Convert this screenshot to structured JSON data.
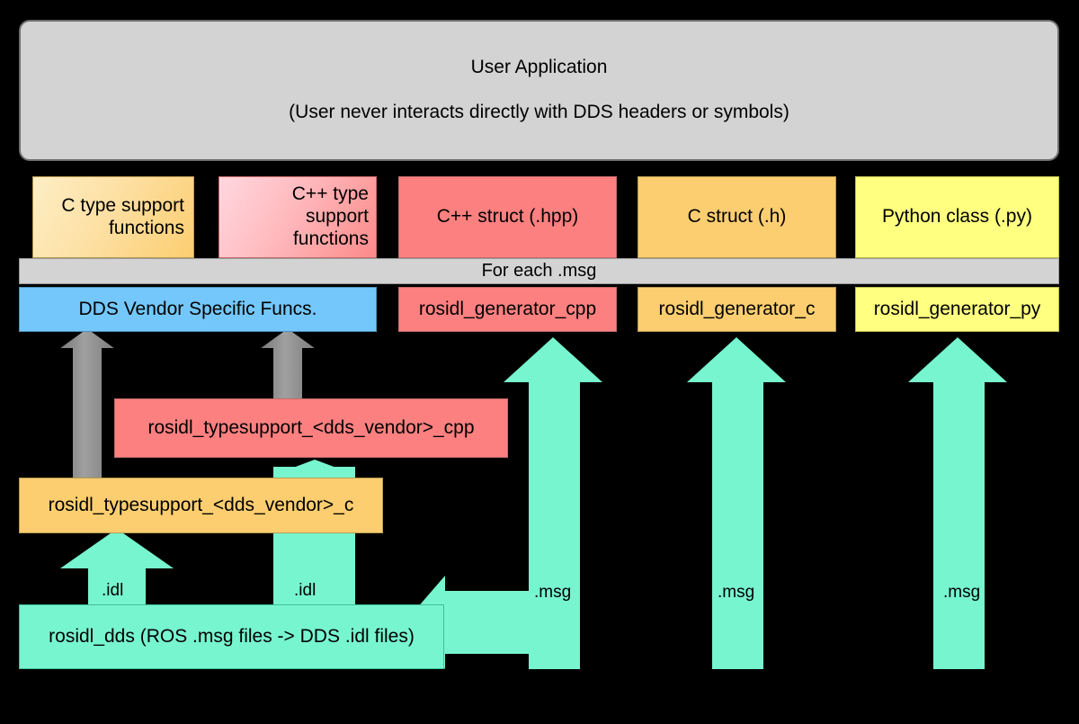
{
  "diagram": {
    "title": "ROS 2 rosidl type support and message generation pipeline",
    "background_color": "#000000",
    "colors": {
      "gray_box": "#d3d3d3",
      "orange": "#fcce70",
      "salmon_red": "#fc8080",
      "yellow": "#ffff80",
      "blue": "#74c7fb",
      "teal_arrow": "#77f5ce",
      "gray_arrow": "#8c8c8c"
    }
  },
  "user_application": {
    "line1": "User Application",
    "line2": "(User never interacts directly with DDS headers or symbols)"
  },
  "artifact_row": [
    {
      "id": "c-type-support",
      "label": "C type support\nfunctions",
      "color": "#fcce70"
    },
    {
      "id": "cpp-type-support",
      "label": "C++ type\nsupport\nfunctions",
      "color": "#fc8a89"
    },
    {
      "id": "cpp-struct",
      "label": "C++ struct (.hpp)",
      "color": "#fc8080"
    },
    {
      "id": "c-struct",
      "label": "C struct (.h)",
      "color": "#fcce70"
    },
    {
      "id": "python-class",
      "label": "Python class (.py)",
      "color": "#ffff80"
    }
  ],
  "for_each_bar": {
    "label": "For each .msg"
  },
  "generator_row": [
    {
      "id": "dds-vendor-funcs",
      "label": "DDS Vendor Specific Funcs.",
      "color": "#74c7fb"
    },
    {
      "id": "rosidl-generator-cpp",
      "label": "rosidl_generator_cpp",
      "color": "#fc8080"
    },
    {
      "id": "rosidl-generator-c",
      "label": "rosidl_generator_c",
      "color": "#fcce70"
    },
    {
      "id": "rosidl-generator-py",
      "label": "rosidl_generator_py",
      "color": "#ffff80"
    }
  ],
  "typesupport_boxes": [
    {
      "id": "ts-vendor-cpp",
      "label": "rosidl_typesupport_<dds_vendor>_cpp",
      "color": "#fc8080"
    },
    {
      "id": "ts-vendor-c",
      "label": "rosidl_typesupport_<dds_vendor>_c",
      "color": "#fcce70"
    }
  ],
  "rosidl_dds": {
    "label": "rosidl_dds (ROS .msg files -> DDS .idl files)",
    "color": "#77f5ce"
  },
  "arrow_labels": {
    "idl_left": ".idl",
    "idl_right": ".idl",
    "msg_cpp": ".msg",
    "msg_c": ".msg",
    "msg_py": ".msg"
  }
}
